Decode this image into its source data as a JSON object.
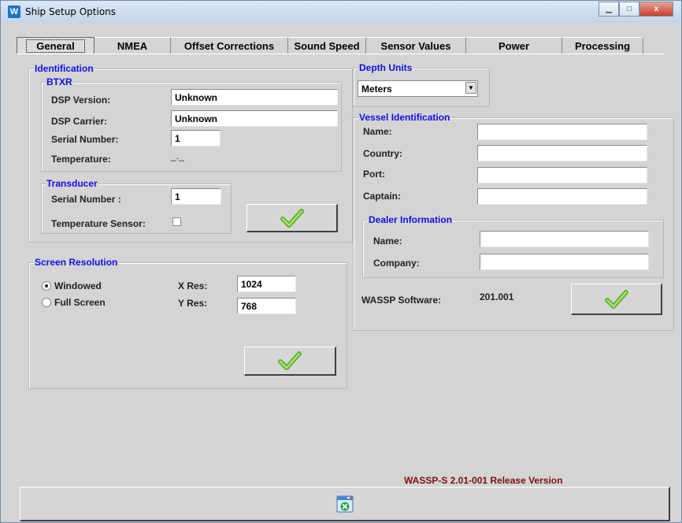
{
  "window": {
    "title": "Ship Setup Options",
    "app_icon": "W",
    "minimize_glyph": "▁",
    "maximize_glyph": "□",
    "close_glyph": "x"
  },
  "tabs": [
    "General",
    "NMEA",
    "Offset Corrections",
    "Sound Speed",
    "Sensor Values",
    "Power",
    "Processing"
  ],
  "identification": {
    "legend": "Identification",
    "btxr": {
      "legend": "BTXR",
      "dsp_version_label": "DSP Version:",
      "dsp_version_value": "Unknown",
      "dsp_carrier_label": "DSP Carrier:",
      "dsp_carrier_value": "Unknown",
      "serial_label": "Serial Number:",
      "serial_value": "1",
      "temperature_label": "Temperature:",
      "temperature_value": "_._"
    },
    "transducer": {
      "legend": "Transducer",
      "serial_label": "Serial Number :",
      "serial_value": "1",
      "temp_sensor_label": "Temperature Sensor:",
      "temp_sensor_checked": false
    }
  },
  "screen_resolution": {
    "legend": "Screen Resolution",
    "windowed_label": "Windowed",
    "fullscreen_label": "Full Screen",
    "selected": "Windowed",
    "xres_label": "X Res:",
    "xres_value": "1024",
    "yres_label": "Y Res:",
    "yres_value": "768"
  },
  "depth_units": {
    "legend": "Depth Units",
    "value": "Meters"
  },
  "vessel": {
    "legend": "Vessel Identification",
    "name_label": "Name:",
    "name_value": "",
    "country_label": "Country:",
    "country_value": "",
    "port_label": "Port:",
    "port_value": "",
    "captain_label": "Captain:",
    "captain_value": "",
    "dealer": {
      "legend": "Dealer Information",
      "name_label": "Name:",
      "name_value": "",
      "company_label": "Company:",
      "company_value": ""
    },
    "software_label": "WASSP Software:",
    "software_value": "201.001"
  },
  "release_text": "WASSP-S 2.01-001 Release Version",
  "icons": {
    "apply": "checkmark-icon",
    "exit": "close-window-icon"
  },
  "colors": {
    "legend": "#1010e6",
    "check_green": "#5fb52a",
    "release_text": "#7a1010"
  }
}
